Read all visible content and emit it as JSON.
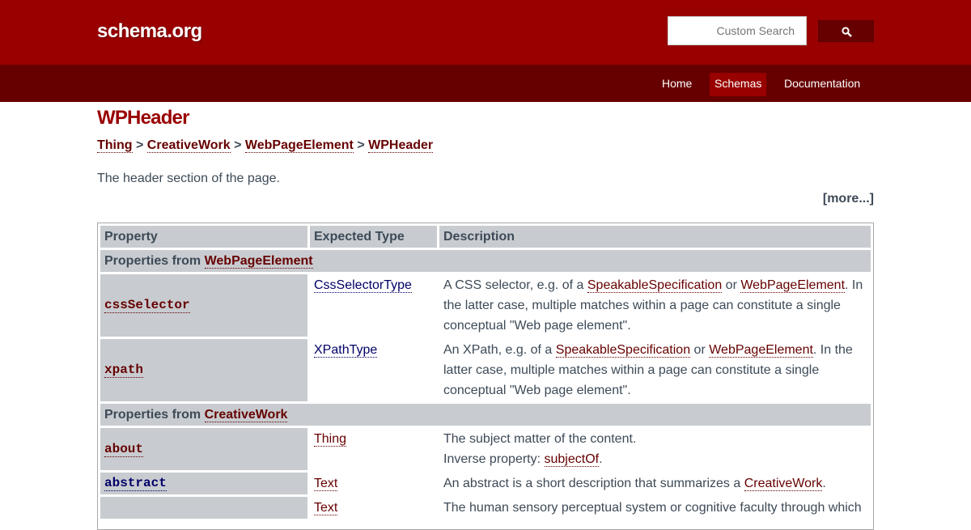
{
  "header": {
    "logo": "schema.org",
    "search_placeholder": "Custom Search",
    "search_icon": "search-icon"
  },
  "nav": {
    "items": [
      {
        "label": "Home"
      },
      {
        "label": "Schemas"
      },
      {
        "label": "Documentation"
      }
    ],
    "active": "Schemas"
  },
  "page": {
    "title": "WPHeader",
    "breadcrumb": [
      "Thing",
      "CreativeWork",
      "WebPageElement",
      "WPHeader"
    ],
    "separator": ">",
    "description": "The header section of the page.",
    "more": "[more...]"
  },
  "table": {
    "headers": [
      "Property",
      "Expected Type",
      "Description"
    ],
    "groups": [
      {
        "prefix": "Properties from ",
        "link": "WebPageElement",
        "rows": [
          {
            "property": "cssSelector",
            "type": "CssSelectorType",
            "desc": [
              "A CSS selector, e.g. of a ",
              "SpeakableSpecification",
              " or ",
              "WebPageElement",
              ". In the latter case, multiple matches within a page can constitute a single conceptual \"Web page element\"."
            ]
          },
          {
            "property": "xpath",
            "type": "XPathType",
            "desc": [
              "An XPath, e.g. of a ",
              "SpeakableSpecification",
              " or ",
              "WebPageElement",
              ". In the latter case, multiple matches within a page can constitute a single conceptual \"Web page element\"."
            ]
          }
        ]
      },
      {
        "prefix": "Properties from ",
        "link": "CreativeWork",
        "rows": [
          {
            "property": "about",
            "type": "Thing",
            "desc": "The subject matter of the content.",
            "inverse_label": "Inverse property: ",
            "inverse_link": "subjectOf",
            "inverse_end": "."
          },
          {
            "property": "abstract",
            "type": "Text",
            "desc_pre": "An abstract is a short description that summarizes a ",
            "desc_link": "CreativeWork",
            "desc_end": "."
          },
          {
            "property": "",
            "type": "Text",
            "desc": "The human sensory perceptual system or cognitive faculty through which"
          }
        ]
      }
    ]
  },
  "colors": {
    "header_bg": "#990000",
    "nav_bg": "#660000",
    "title": "#990000",
    "link_red": "#660000",
    "link_blue": "#000066",
    "cell_grey": "#c8ccd0"
  }
}
